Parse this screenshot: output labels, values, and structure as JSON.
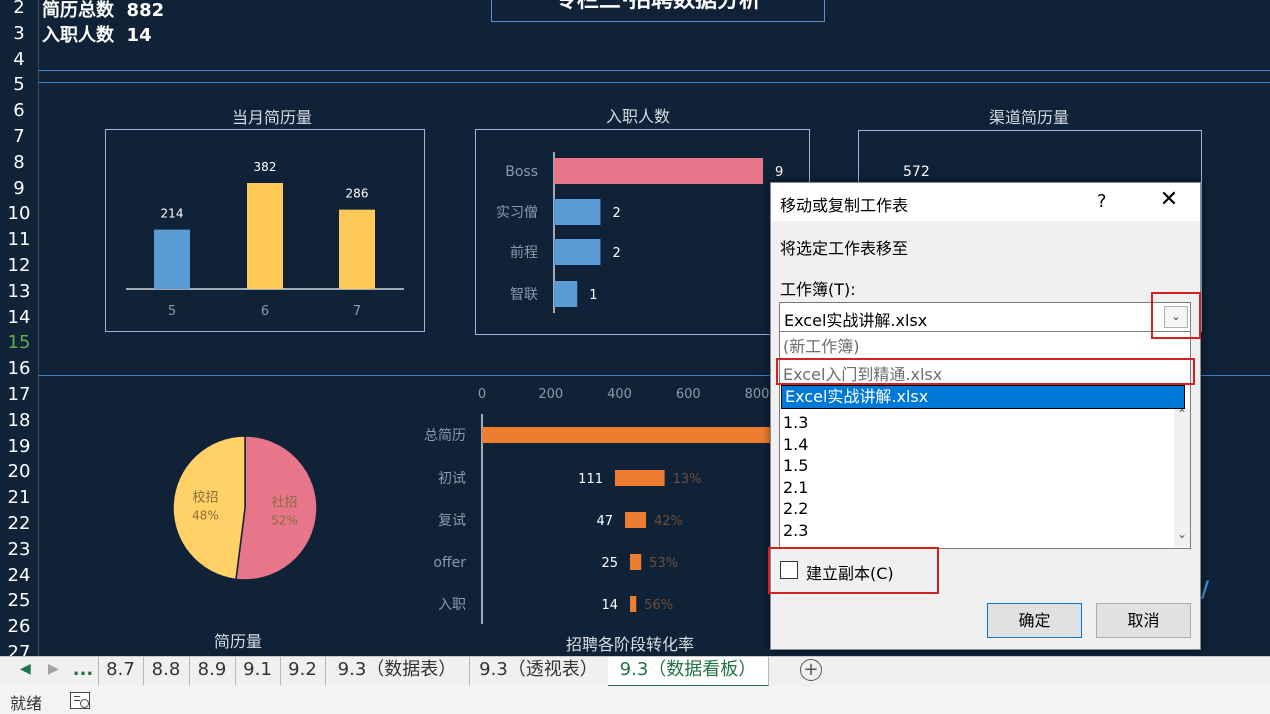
{
  "rows": [
    "2",
    "3",
    "4",
    "5",
    "6",
    "7",
    "8",
    "9",
    "10",
    "11",
    "12",
    "13",
    "14",
    "15",
    "16",
    "17",
    "18",
    "19",
    "20",
    "21",
    "22",
    "23",
    "24",
    "25",
    "26",
    "27"
  ],
  "info": {
    "resume_total_label": "简历总数",
    "resume_total_value": "882",
    "hired_label": "入职人数",
    "hired_value": "14"
  },
  "dashboard_title": "专栏三·招聘数据分析",
  "charts": {
    "monthly": {
      "title": "当月简历量"
    },
    "hired": {
      "title": "入职人数"
    },
    "channel": {
      "title": "渠道简历量",
      "visible_value": "572"
    },
    "pie": {
      "title": "简历量"
    },
    "funnel": {
      "title": "招聘各阶段转化率"
    }
  },
  "chart_data": [
    {
      "type": "bar",
      "title": "当月简历量",
      "categories": [
        "5",
        "6",
        "7"
      ],
      "values": [
        214,
        382,
        286
      ],
      "colors": [
        "#5b9bd5",
        "#ffc957",
        "#ffc957"
      ]
    },
    {
      "type": "bar",
      "orientation": "horizontal",
      "title": "入职人数",
      "categories": [
        "Boss",
        "实习僧",
        "前程",
        "智联"
      ],
      "values": [
        9,
        2,
        2,
        1
      ],
      "colors": [
        "#e8768a",
        "#5b9bd5",
        "#5b9bd5",
        "#5b9bd5"
      ]
    },
    {
      "type": "pie",
      "title": "简历量",
      "slices": [
        {
          "label": "校招",
          "value": 48,
          "pct": "48%",
          "color": "#ffd166"
        },
        {
          "label": "社招",
          "value": 52,
          "pct": "52%",
          "color": "#e8768a"
        }
      ]
    },
    {
      "type": "bar",
      "orientation": "horizontal",
      "title": "招聘各阶段转化率",
      "x_ticks": [
        "0",
        "200",
        "400",
        "600",
        "800"
      ],
      "xlim": [
        0,
        800
      ],
      "categories": [
        "总简历",
        "初试",
        "复试",
        "offer",
        "入职"
      ],
      "values": [
        882,
        111,
        47,
        25,
        14
      ],
      "rates": [
        "",
        "13%",
        "42%",
        "53%",
        "56%"
      ],
      "color": "#ed7d31"
    }
  ],
  "dialog": {
    "title": "移动或复制工作表",
    "help": "?",
    "close": "✕",
    "move_to_label": "将选定工作表移至",
    "workbook_label": "工作簿(T):",
    "workbook_value": "Excel实战讲解.xlsx",
    "list_items": [
      "(新工作簿)",
      "Excel入门到精通.xlsx",
      "Excel实战讲解.xlsx",
      "1.3",
      "1.4",
      "1.5",
      "2.1",
      "2.2",
      "2.3"
    ],
    "selected_index": 2,
    "copy_label": "建立副本(C)",
    "copy_checked": false,
    "ok": "确定",
    "cancel": "取消"
  },
  "sheet_tabs": [
    "...",
    "8.7",
    "8.8",
    "8.9",
    "9.1",
    "9.2",
    "9.3（数据表）",
    "9.3（透视表）",
    "9.3（数据看板）"
  ],
  "active_tab": "9.3（数据看板）",
  "status": {
    "ready": "就绪"
  },
  "colors": {
    "background": "#0f2238",
    "accent_red": "#d42020",
    "excel_green": "#217346"
  }
}
